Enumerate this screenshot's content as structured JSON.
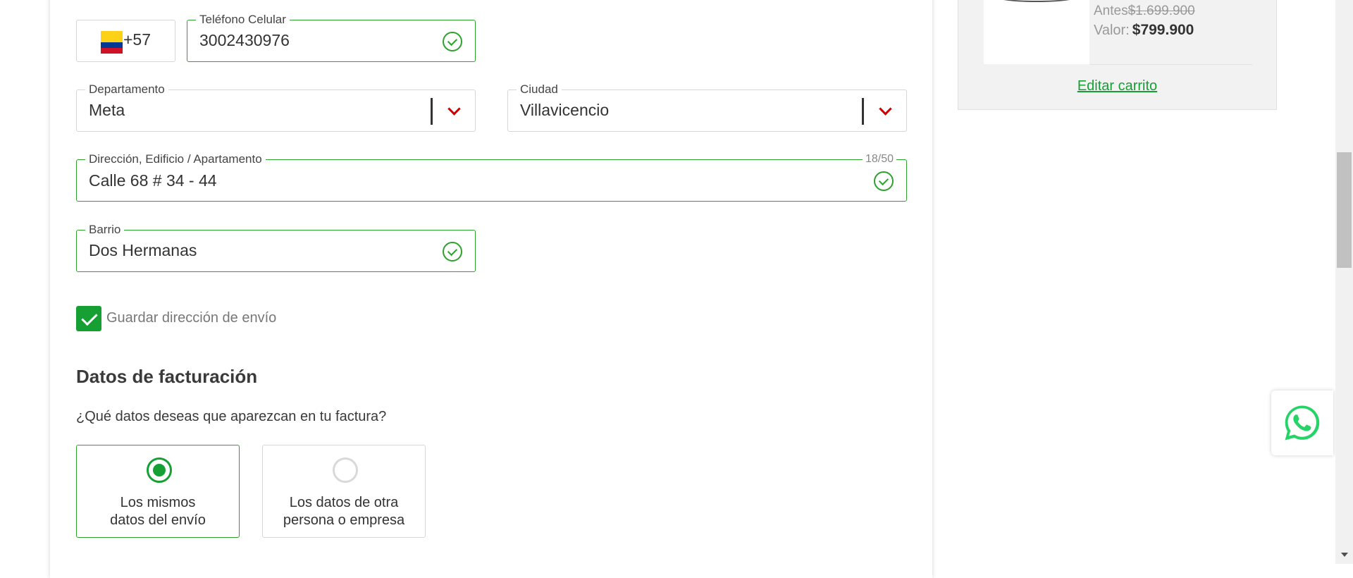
{
  "phone": {
    "country_code": "+57",
    "flag_icon": "colombia-flag-icon",
    "label": "Teléfono Celular",
    "value": "3002430976"
  },
  "departamento": {
    "label": "Departamento",
    "value": "Meta"
  },
  "ciudad": {
    "label": "Ciudad",
    "value": "Villavicencio"
  },
  "direccion": {
    "label": "Dirección, Edificio / Apartamento",
    "value": "Calle 68 # 34 - 44",
    "counter": "18/50"
  },
  "barrio": {
    "label": "Barrio",
    "value": "Dos Hermanas"
  },
  "save_address": {
    "label": "Guardar dirección de envío",
    "checked": true
  },
  "billing": {
    "title": "Datos de facturación",
    "question": "¿Qué datos deseas que aparezcan en tu factura?",
    "options": [
      {
        "line1": "Los mismos",
        "line2": "datos del envío",
        "selected": true
      },
      {
        "line1": "Los datos de otra",
        "line2": "persona o empresa",
        "selected": false
      }
    ]
  },
  "cart": {
    "antes_label": "Antes",
    "antes_price": "$1.699.900",
    "valor_label": "Valor:",
    "valor_price": "$799.900",
    "edit_link": "Editar carrito"
  },
  "colors": {
    "accent": "#16a034",
    "valid_border": "#2ea12e",
    "chevron": "#cc0000",
    "whatsapp": "#25d366"
  },
  "whatsapp": {
    "icon": "whatsapp-icon"
  }
}
